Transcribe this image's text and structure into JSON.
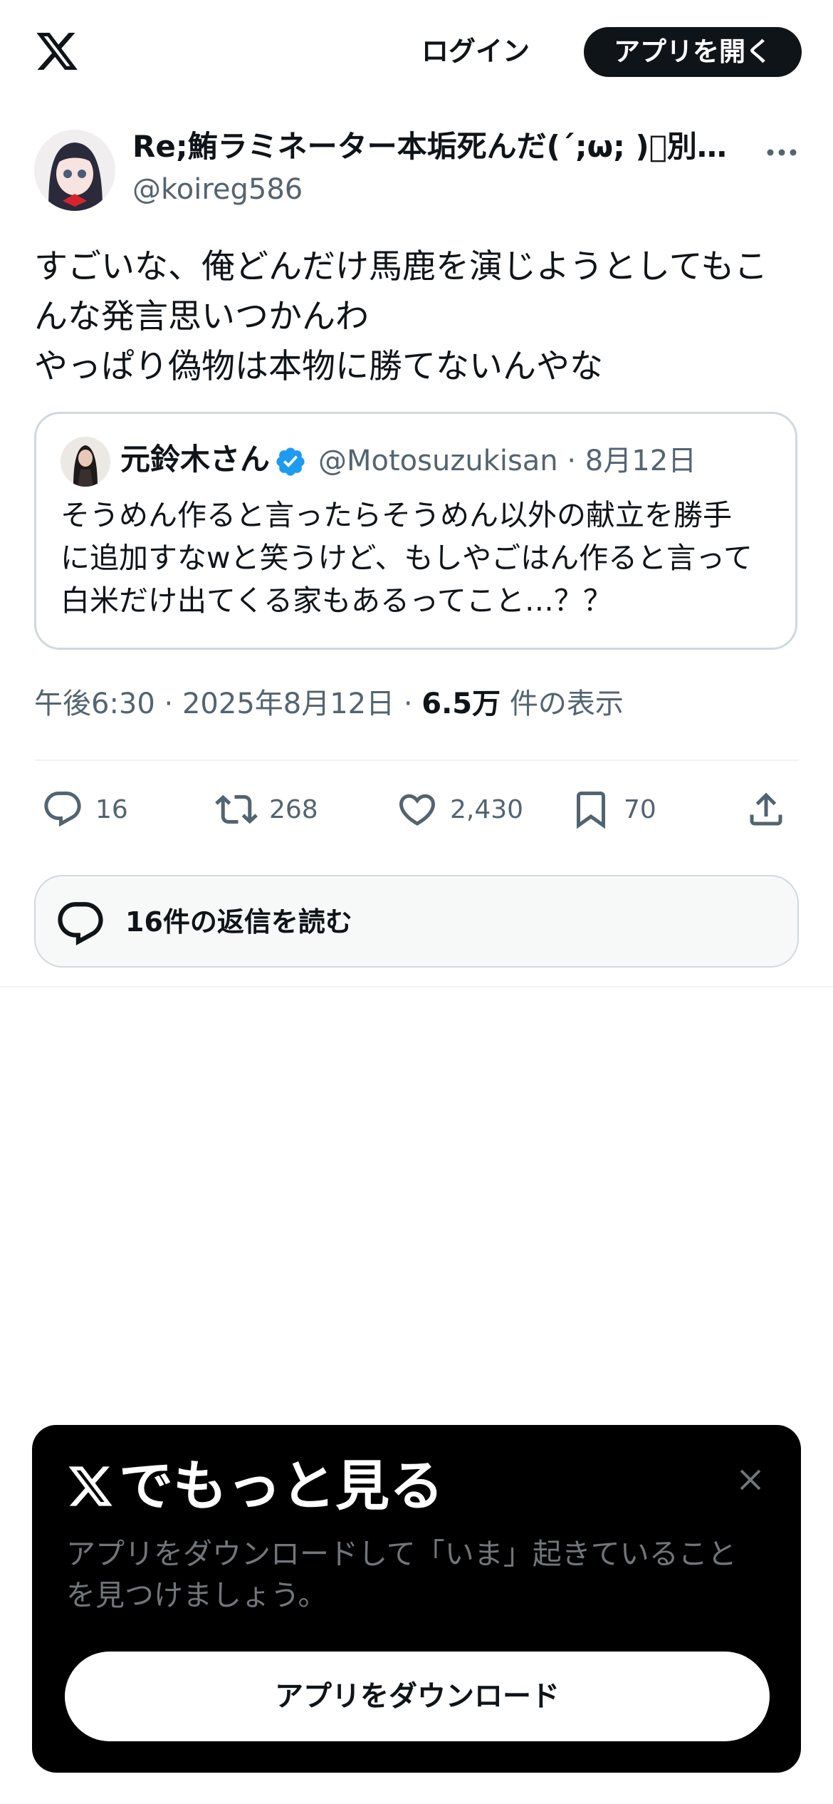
{
  "topbar": {
    "logo_icon": "x-logo-icon",
    "login_label": "ログイン",
    "open_app_label": "アプリを開く"
  },
  "tweet": {
    "author_name": "Re;鮪ラミネーター本垢死んだ(´;ω; )ﾞ別…",
    "author_handle": "@koireg586",
    "text_lines": [
      "すごいな、俺どんだけ馬鹿を演じようとしてもこ",
      "んな発言思いつかんわ",
      "やっぱり偽物は本物に勝てないんやな"
    ],
    "quote": {
      "name": "元鈴木さん",
      "handle_date": "@Motosuzukisan · 8月12日",
      "text_lines": [
        "そうめん作ると言ったらそうめん以外の献立を勝手",
        "に追加すなwと笑うけど、もしやごはん作ると言って",
        "白米だけ出てくる家もあるってこと…？？"
      ]
    },
    "meta": {
      "time_date": "午後6:30 · 2025年8月12日 · ",
      "views_count": "6.5万",
      "views_label": " 件の表示"
    },
    "actions": {
      "replies": "16",
      "retweets": "268",
      "likes": "2,430",
      "bookmarks": "70"
    },
    "read_replies_label": "16件の返信を読む"
  },
  "sheet": {
    "title": "でもっと見る",
    "description_lines": [
      "アプリをダウンロードして「いま」起きていること",
      "を見つけましょう。"
    ],
    "download_label": "アプリをダウンロード"
  },
  "colors": {
    "text": "#0f1419",
    "secondary": "#536471",
    "border": "#cfd9de",
    "verified": "#1d9bf0",
    "sheet_bg": "#000000"
  }
}
